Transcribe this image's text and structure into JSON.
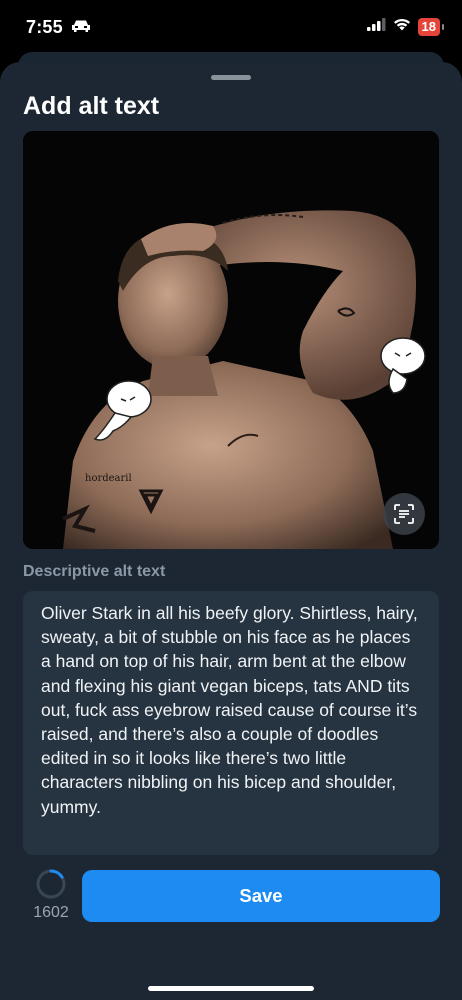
{
  "status_bar": {
    "time": "7:55",
    "battery": "18",
    "icons": [
      "car-icon",
      "signal-icon",
      "wifi-icon",
      "battery-icon"
    ]
  },
  "sheet": {
    "title": "Add alt text",
    "image": {
      "subject": "shirtless-man-with-doodles",
      "scan_icon": "text-recognition-icon"
    },
    "field_label": "Descriptive alt text",
    "alt_text": "Oliver Stark in all his beefy glory. Shirtless, hairy, sweaty, a bit of stubble on his face as he places a hand on top of his hair, arm bent at the elbow and flexing his giant vegan biceps, tats AND tits out, fuck ass eyebrow raised cause of course it’s raised, and there’s also a couple of doodles edited in so it looks like there’s two little characters nibbling on his bicep and shoulder, yummy.",
    "char_remaining": "1602",
    "char_used_fraction": 0.16,
    "save_label": "Save"
  },
  "colors": {
    "sheet_bg": "#1c2733",
    "field_bg": "#263340",
    "accent": "#1d8bf1",
    "muted_text": "#8b98a5"
  }
}
